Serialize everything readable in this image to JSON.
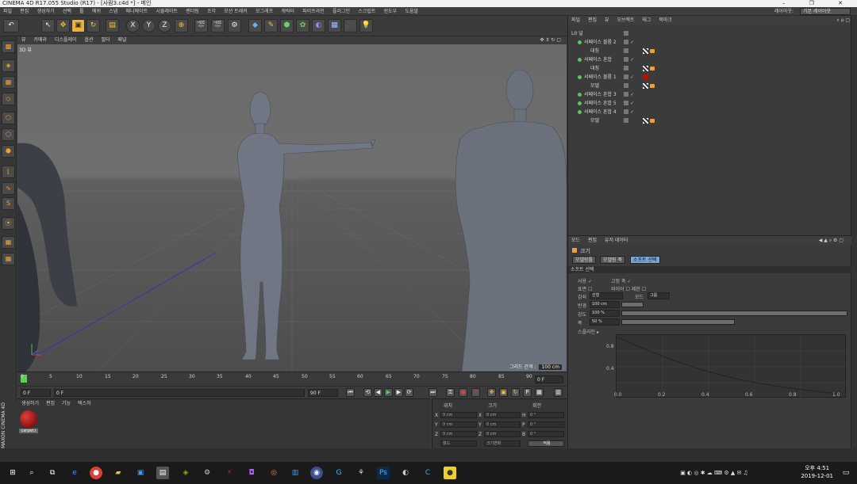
{
  "window": {
    "title": "CINEMA 4D R17.055 Studio (R17) - [사람3.c4d *] - 메인",
    "controls": "–  ❐  ✕"
  },
  "menubar": {
    "items": [
      "파일",
      "편집",
      "생성하기",
      "선택",
      "툴",
      "메쉬",
      "스냅",
      "애니메이트",
      "시뮬레이트",
      "렌더링",
      "조각",
      "모션 트래커",
      "모그래프",
      "캐릭터",
      "파이프라인",
      "플러그인",
      "스크립트",
      "윈도우",
      "도움말"
    ],
    "layout_label": "레이아웃:",
    "layout_value": "기본 레이아웃"
  },
  "toolbar": {
    "undo": "↶",
    "axis_x": "X",
    "axis_y": "Y",
    "axis_z": "Z"
  },
  "viewport": {
    "menu": [
      "뷰",
      "카메라",
      "디스플레이",
      "옵션",
      "필터",
      "패널"
    ],
    "label": "3D 뷰",
    "grid_label": "그리드 간격 :",
    "grid_value": "100 cm"
  },
  "timeline": {
    "ticks": [
      "0",
      "5",
      "10",
      "15",
      "20",
      "25",
      "30",
      "35",
      "40",
      "45",
      "50",
      "55",
      "60",
      "65",
      "70",
      "75",
      "80",
      "85",
      "90"
    ],
    "current_frame": "0 F"
  },
  "playbar": {
    "start_frame": "0 F",
    "min_frame": "0 F",
    "end_frame": "90 F",
    "max_frame": "90 F"
  },
  "materials": {
    "menu": [
      "생성하기",
      "편집",
      "기능",
      "텍스처"
    ],
    "items": [
      {
        "label": "carpet.l"
      }
    ]
  },
  "coords": {
    "pos_label": "위치",
    "size_label": "크기",
    "rot_label": "회전",
    "rows": [
      {
        "a": "X",
        "av": "0 cm",
        "b": "X",
        "bv": "0 cm",
        "c": "H",
        "cv": "0 °"
      },
      {
        "a": "Y",
        "av": "0 cm",
        "b": "Y",
        "bv": "0 cm",
        "c": "P",
        "cv": "0 °"
      },
      {
        "a": "Z",
        "av": "0 cm",
        "b": "Z",
        "bv": "0 cm",
        "c": "B",
        "cv": "0 °"
      }
    ],
    "mode": "월드",
    "size_mode": "크기변화",
    "apply": "적용"
  },
  "objects": {
    "menu": [
      "파일",
      "편집",
      "뷰",
      "오브젝트",
      "태그",
      "북마크"
    ],
    "rows": [
      {
        "indent": 0,
        "name": "L0 널"
      },
      {
        "indent": 0,
        "name": "서페이스 볼륨 2"
      },
      {
        "indent": 1,
        "name": "대칭"
      },
      {
        "indent": 0,
        "name": "서페이스 혼합"
      },
      {
        "indent": 1,
        "name": "대칭"
      },
      {
        "indent": 0,
        "name": "서페이스 볼륨 1"
      },
      {
        "indent": 1,
        "name": "모델"
      },
      {
        "indent": 0,
        "name": "서페이스 혼합 3"
      },
      {
        "indent": 0,
        "name": "서페이스 혼합 5"
      },
      {
        "indent": 0,
        "name": "서페이스 혼합 4"
      },
      {
        "indent": 1,
        "name": "모델"
      }
    ]
  },
  "attributes": {
    "menu": [
      "모드",
      "편집",
      "유저 데이터"
    ],
    "title": "크기",
    "tabs": [
      "모델링툴",
      "모델링 축",
      "소프트 선택"
    ],
    "section": "소프트 선택",
    "rows": [
      {
        "label": "사용 ✓",
        "value": "고정 축 ✓"
      },
      {
        "label": "표면 ☐",
        "value": "와이어 ☐ 제한 ☐"
      },
      {
        "label": "감쇠",
        "value": "선형",
        "value2": "모드",
        "value3": "그룹"
      },
      {
        "label": "반경",
        "value": "100 cm"
      },
      {
        "label": "강도",
        "value": "100 %"
      },
      {
        "label": "폭",
        "value": "50 %"
      }
    ],
    "curve_label": "스플라인 ▸",
    "curve_x": [
      "0.0",
      "0.2",
      "0.4",
      "0.6",
      "0.8",
      "1.0"
    ],
    "curve_y": [
      "0.8",
      "0.4"
    ]
  },
  "taskbar": {
    "time": "오후 4:51",
    "date": "2019-12-01"
  },
  "branding": {
    "maxon": "MAXON CINEMA 4D"
  }
}
